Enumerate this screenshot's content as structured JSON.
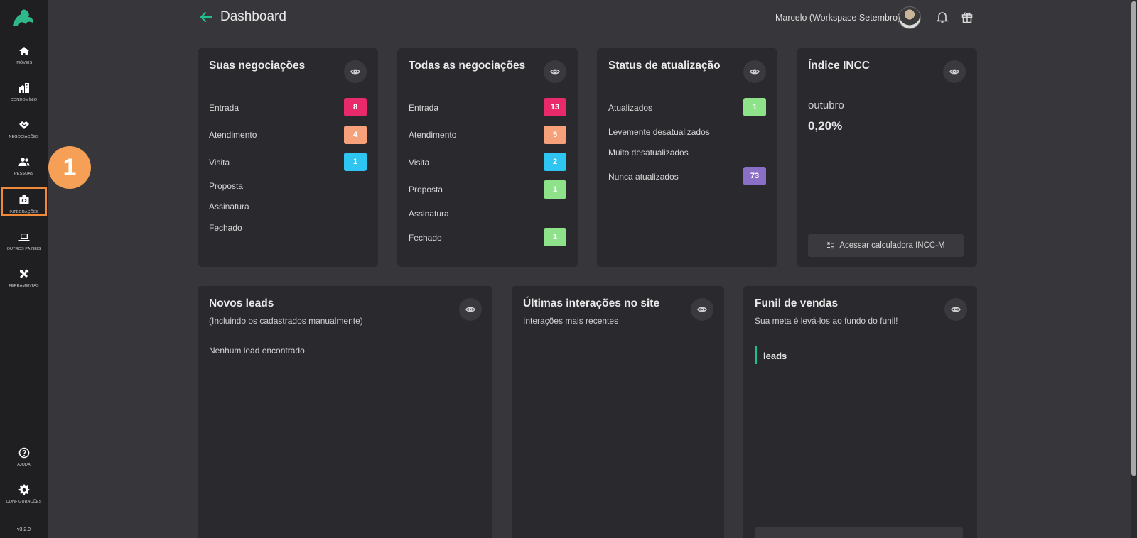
{
  "sidebar": {
    "items": [
      {
        "label": "IMÓVEIS",
        "icon": "home-icon"
      },
      {
        "label": "CONDOMÍNIO",
        "icon": "building-icon"
      },
      {
        "label": "NEGOCIAÇÕES",
        "icon": "handshake-icon"
      },
      {
        "label": "PESSOAS",
        "icon": "people-icon"
      },
      {
        "label": "INTEGRAÇÕES",
        "icon": "integrations-icon"
      },
      {
        "label": "OUTROS PAINÉIS",
        "icon": "laptop-icon"
      },
      {
        "label": "FERRAMENTAS",
        "icon": "tools-icon"
      }
    ],
    "help_label": "AJUDA",
    "settings_label": "CONFIGURAÇÕES",
    "version": "v3.2.0"
  },
  "step_number": "1",
  "header": {
    "title": "Dashboard",
    "user": "Marcelo (Workspace Setembro)"
  },
  "colors": {
    "accent": "#1fbf8f",
    "pink": "#e8296a",
    "orange": "#f7a17b",
    "blue": "#2ec5f2",
    "green": "#8ee28a",
    "purple": "#8a6fc6",
    "highlight": "#f08a3b"
  },
  "cards": {
    "suas": {
      "title": "Suas negociações",
      "rows": [
        {
          "label": "Entrada",
          "count": "8"
        },
        {
          "label": "Atendimento",
          "count": "4"
        },
        {
          "label": "Visita",
          "count": "1"
        },
        {
          "label": "Proposta",
          "count": ""
        },
        {
          "label": "Assinatura",
          "count": ""
        },
        {
          "label": "Fechado",
          "count": ""
        }
      ]
    },
    "todas": {
      "title": "Todas as negociações",
      "rows": [
        {
          "label": "Entrada",
          "count": "13"
        },
        {
          "label": "Atendimento",
          "count": "5"
        },
        {
          "label": "Visita",
          "count": "2"
        },
        {
          "label": "Proposta",
          "count": "1"
        },
        {
          "label": "Assinatura",
          "count": ""
        },
        {
          "label": "Fechado",
          "count": "1"
        }
      ]
    },
    "status": {
      "title": "Status de atualização",
      "rows": [
        {
          "label": "Atualizados",
          "count": "1"
        },
        {
          "label": "Levemente desatualizados",
          "count": ""
        },
        {
          "label": "Muito desatualizados",
          "count": ""
        },
        {
          "label": "Nunca atualizados",
          "count": "73"
        }
      ]
    },
    "incc": {
      "title": "Índice INCC",
      "month": "outubro",
      "value": "0,20%",
      "button": "Acessar calculadora INCC-M"
    },
    "leads": {
      "title": "Novos leads",
      "subtitle": "(Incluindo os cadastrados manualmente)",
      "empty": "Nenhum lead encontrado."
    },
    "interacoes": {
      "title": "Últimas interações no site",
      "subtitle": "Interações mais recentes"
    },
    "funil": {
      "title": "Funil de vendas",
      "subtitle": "Sua meta é levá-los ao fundo do funil!",
      "stage": "leads"
    }
  }
}
